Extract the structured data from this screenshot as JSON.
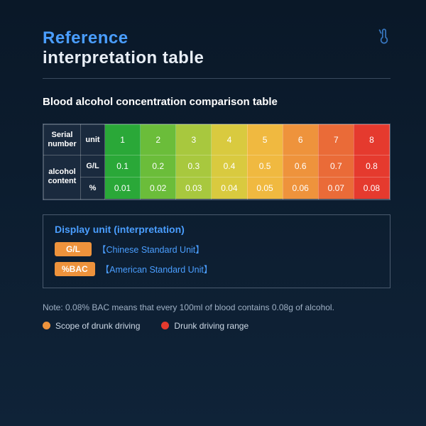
{
  "title": {
    "line1": "Reference",
    "line2": "interpretation table"
  },
  "subtitle": "Blood alcohol concentration comparison table",
  "table": {
    "headers": {
      "serial": "Serial number",
      "unit": "unit",
      "alcohol": "alcohol content"
    },
    "serials": [
      "1",
      "2",
      "3",
      "4",
      "5",
      "6",
      "7",
      "8"
    ],
    "rows": [
      {
        "unit": "G/L",
        "values": [
          "0.1",
          "0.2",
          "0.3",
          "0.4",
          "0.5",
          "0.6",
          "0.7",
          "0.8"
        ]
      },
      {
        "unit": "%",
        "values": [
          "0.01",
          "0.02",
          "0.03",
          "0.04",
          "0.05",
          "0.06",
          "0.07",
          "0.08"
        ]
      }
    ]
  },
  "interp": {
    "title": "Display unit (interpretation)",
    "gl": {
      "pill": "G/L",
      "label": "【Chinese Standard Unit】"
    },
    "bac": {
      "pill": "%BAC",
      "label": "【American Standard Unit】"
    }
  },
  "note": "Note: 0.08% BAC means that every 100ml of blood contains 0.08g of alcohol.",
  "legend": {
    "drunk_scope": "Scope of drunk driving",
    "drunk_range": "Drunk driving range"
  },
  "chart_data": {
    "type": "table",
    "title": "Blood alcohol concentration comparison table",
    "categories": [
      1,
      2,
      3,
      4,
      5,
      6,
      7,
      8
    ],
    "series": [
      {
        "name": "G/L",
        "values": [
          0.1,
          0.2,
          0.3,
          0.4,
          0.5,
          0.6,
          0.7,
          0.8
        ]
      },
      {
        "name": "%",
        "values": [
          0.01,
          0.02,
          0.03,
          0.04,
          0.05,
          0.06,
          0.07,
          0.08
        ]
      }
    ],
    "color_scale": [
      "#2aa838",
      "#6bbd3a",
      "#a8c83e",
      "#d9ca3f",
      "#f0b940",
      "#ee933c",
      "#ea6b38",
      "#e53a2e"
    ]
  }
}
